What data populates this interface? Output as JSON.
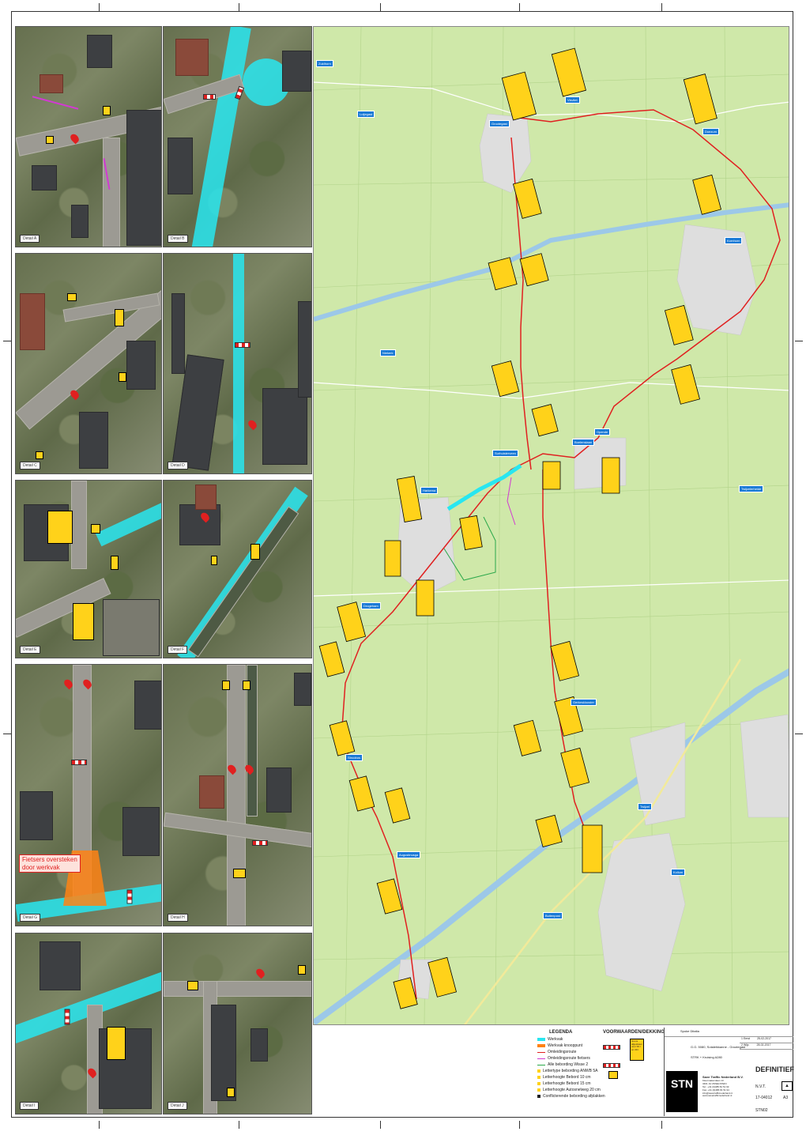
{
  "panels": [
    {
      "id": "p1",
      "label": "Detail A"
    },
    {
      "id": "p2",
      "label": "Detail B"
    },
    {
      "id": "p3",
      "label": "Detail C"
    },
    {
      "id": "p4",
      "label": "Detail D"
    },
    {
      "id": "p5",
      "label": "Detail E"
    },
    {
      "id": "p6",
      "label": "Detail F"
    },
    {
      "id": "p7",
      "label": "Detail G",
      "callout": "Fietsers oversteken\ndoor werkvak"
    },
    {
      "id": "p8",
      "label": "Detail H"
    },
    {
      "id": "p9",
      "label": "Detail I"
    },
    {
      "id": "p10",
      "label": "Detail J"
    }
  ],
  "legend": {
    "legenda_title": "LEGENDA",
    "voorwaarden_title": "VOORWAARDEN/DEKKING",
    "items": [
      {
        "label": "Werkvak",
        "color": "#28e6f0"
      },
      {
        "label": "Werkvak knooppunt",
        "color": "#ff8214"
      },
      {
        "label": "Omleidingsroute",
        "color": "#e02020"
      },
      {
        "label": "Omleidingsroute fietsers",
        "color": "#d23ad2"
      },
      {
        "label": "Alle bebording Wisse 2",
        "color": "#2aa84a"
      },
      {
        "label": "Lettertype bebording ANWB 5A",
        "color": "#ffd21a"
      },
      {
        "label": "Letterhoogte Bebord 10 cm",
        "color": "#ffd21a"
      },
      {
        "label": "Letterhoogte Bebord 15 cm",
        "color": "#ffd21a"
      },
      {
        "label": "Letterhoogte Autosnelweg 20 cm",
        "color": "#ffd21a"
      },
      {
        "label": "Conflicterende bebording afplakken",
        "color": "#222222"
      }
    ],
    "note_lines": [
      "Grens",
      "afgesloten",
      "voor 39 t",
      "en 39 t"
    ]
  },
  "titleblock": {
    "project": "Spoke Ditalta",
    "client_line": "G.G. 5080, Sotaleikkanne - Grootegast",
    "subject_line": "STRK + Kruising A280",
    "status": "DEFINITIEF",
    "company": "Save Traffic Nederland B.V.",
    "company_lines": [
      "Kleermakerslaan 13",
      "3401 JA IJSSELSTEIN",
      "Tel.: +31 (0)485 81 51 93",
      "Fax: +31 (0)485 81 51 94",
      "info@savetrafficnederland.nl",
      "www.savetrafficnederland.nl"
    ],
    "logo_text": "STN",
    "scale": "N.V.T.",
    "drawing_no": "17-04012",
    "sheet_size": "A3",
    "code": "STN02",
    "rev_rows": [
      {
        "rev": "1",
        "desc": "Eerst",
        "date": "25-02-2017"
      },
      {
        "rev": "2",
        "desc": "Wijz.",
        "date": "28-02-2017"
      }
    ]
  },
  "map": {
    "towns": [
      {
        "name": "Grootegast"
      },
      {
        "name": "Lutjegast"
      },
      {
        "name": "Doezum"
      },
      {
        "name": "Kornhorn"
      },
      {
        "name": "Opende"
      },
      {
        "name": "Surhuisterveen"
      },
      {
        "name": "Harkema"
      },
      {
        "name": "Buitenpost"
      },
      {
        "name": "Twijzel"
      },
      {
        "name": "Kollum"
      },
      {
        "name": "Augustinusga"
      },
      {
        "name": "Stroobos"
      },
      {
        "name": "Gerkesklooster"
      },
      {
        "name": "Boelenslaan"
      },
      {
        "name": "Drogeham"
      },
      {
        "name": "Twijzelerheide"
      },
      {
        "name": "Zuidhorn"
      },
      {
        "name": "Visvliet"
      },
      {
        "name": "Niekerk"
      }
    ]
  }
}
